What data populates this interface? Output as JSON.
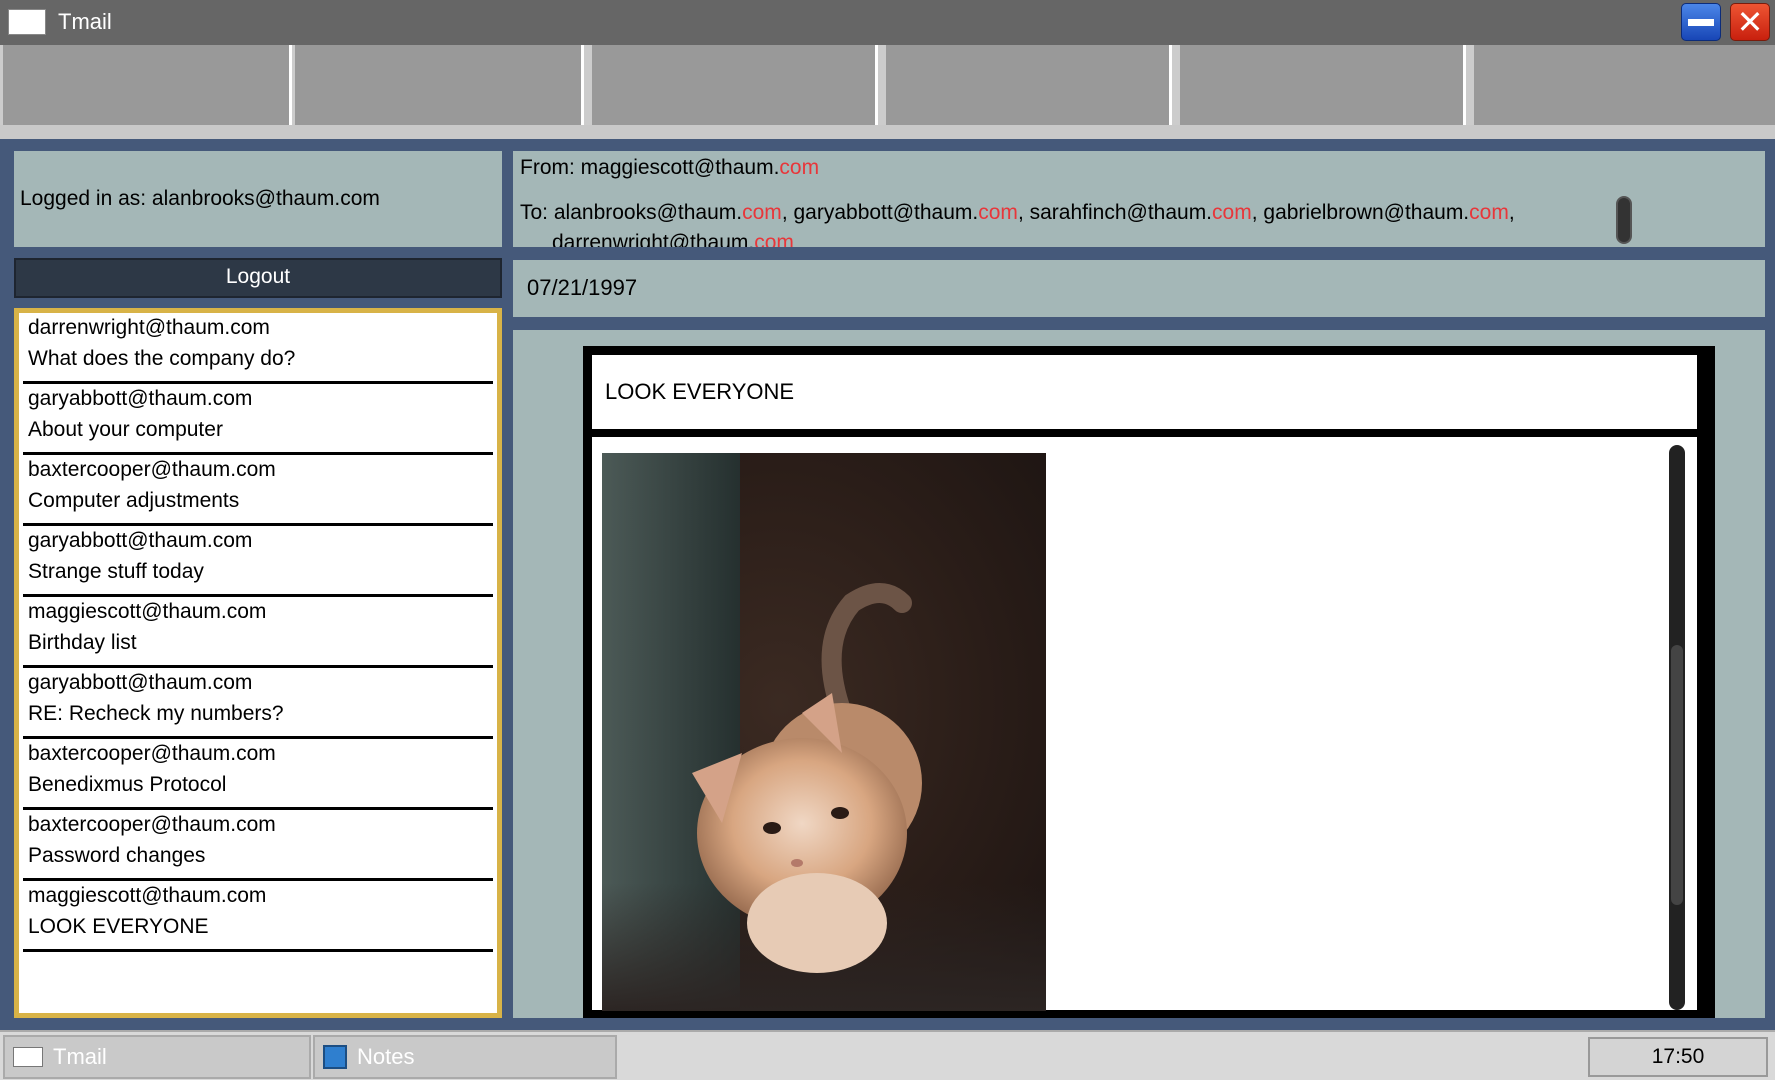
{
  "window": {
    "title": "Tmail",
    "minimize_icon": "minimize-icon",
    "close_icon": "close-icon"
  },
  "sidebar": {
    "logged_in_label": "Logged in as: alanbrooks@thaum.com",
    "logout_label": "Logout",
    "messages": [
      {
        "sender": "darrenwright@thaum.com",
        "subject": "What does the company do?"
      },
      {
        "sender": "garyabbott@thaum.com",
        "subject": "About your computer"
      },
      {
        "sender": "baxtercooper@thaum.com",
        "subject": "Computer adjustments"
      },
      {
        "sender": "garyabbott@thaum.com",
        "subject": "Strange stuff today"
      },
      {
        "sender": "maggiescott@thaum.com",
        "subject": "Birthday list"
      },
      {
        "sender": "garyabbott@thaum.com",
        "subject": "RE: Recheck my numbers?"
      },
      {
        "sender": "baxtercooper@thaum.com",
        "subject": "Benedixmus Protocol"
      },
      {
        "sender": "baxtercooper@thaum.com",
        "subject": "Password changes"
      },
      {
        "sender": "maggiescott@thaum.com",
        "subject": "LOOK EVERYONE"
      }
    ]
  },
  "message": {
    "from_label": "From: ",
    "from_user": "maggiescott@thaum.",
    "from_domain": "com",
    "to_label": "To: ",
    "recipients": [
      {
        "user": "alanbrooks@thaum.",
        "domain": "com"
      },
      {
        "user": "garyabbott@thaum.",
        "domain": "com"
      },
      {
        "user": "sarahfinch@thaum.",
        "domain": "com"
      },
      {
        "user": "gabrielbrown@thaum.",
        "domain": "com"
      },
      {
        "user": "darrenwright@thaum.",
        "domain": "com"
      }
    ],
    "date": "07/21/1997",
    "subject": "LOOK EVERYONE",
    "attachment": "cat-photo"
  },
  "taskbar": {
    "apps": [
      {
        "label": "Tmail",
        "icon": "tmail-icon"
      },
      {
        "label": "Notes",
        "icon": "notes-icon"
      }
    ],
    "clock": "17:50"
  },
  "colors": {
    "desktop": "#45597a",
    "panel": "#a4b7b7",
    "domain_highlight": "#e8363a",
    "list_border": "#d8b347",
    "logout_bg": "#2d3846"
  }
}
